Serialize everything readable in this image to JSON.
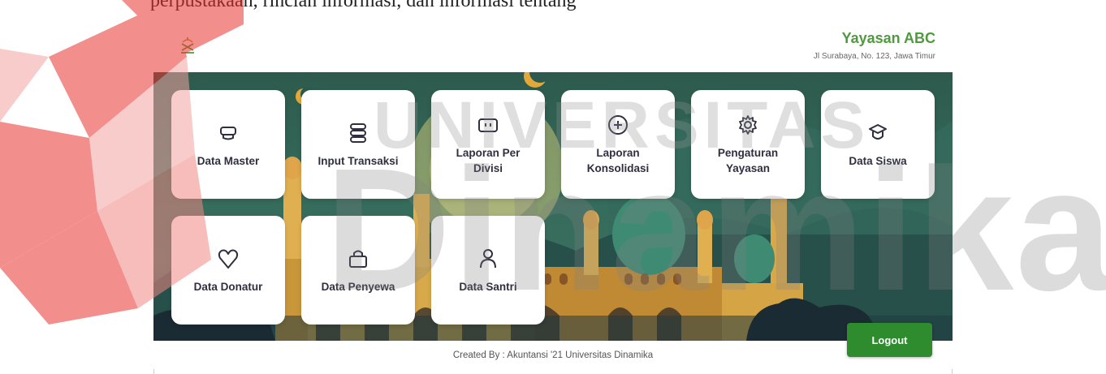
{
  "top_caption": "perpustakaan, rincian informasi, dan informasi tentang",
  "header": {
    "org_name": "Yayasan ABC",
    "org_address": "Jl Surabaya, No. 123, Jawa Timur",
    "logo_icon": "yayasan-logo-icon"
  },
  "tiles": [
    {
      "label": "Data Master",
      "icon": "database-icon"
    },
    {
      "label": "Input Transaksi",
      "icon": "stack-icon"
    },
    {
      "label": "Laporan Per Divisi",
      "icon": "report-box-icon"
    },
    {
      "label": "Laporan Konsolidasi",
      "icon": "plus-circle-icon"
    },
    {
      "label": "Pengaturan Yayasan",
      "icon": "gear-icon"
    },
    {
      "label": "Data Siswa",
      "icon": "graduation-cap-icon"
    },
    {
      "label": "Data Donatur",
      "icon": "heart-icon"
    },
    {
      "label": "Data Penyewa",
      "icon": "bag-icon"
    },
    {
      "label": "Data Santri",
      "icon": "user-icon"
    }
  ],
  "logout_label": "Logout",
  "footer": "Created By : Akuntansi '21 Universitas Dinamika",
  "watermark": {
    "line1": "UNIVERSITAS",
    "line2": "Dinamika"
  },
  "colors": {
    "brand_green": "#4f9a3e",
    "logout_green": "#2e8b2e",
    "watermark_red": "#e8332f"
  }
}
